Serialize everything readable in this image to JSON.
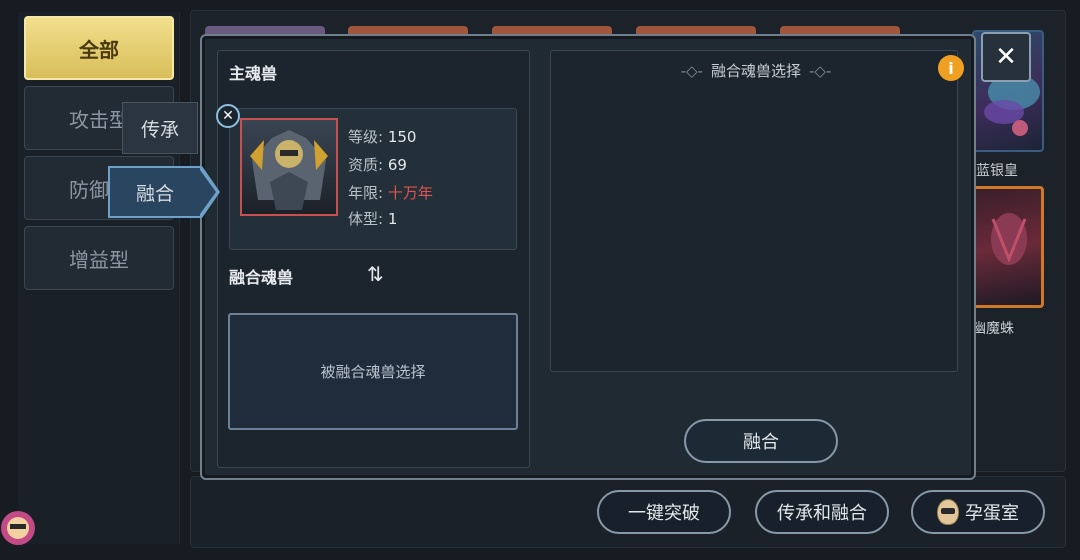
{
  "sidebar": {
    "categories": [
      "全部",
      "攻击型",
      "防御型",
      "增益型"
    ]
  },
  "side_cards": [
    "蓝银皇",
    "幽魔蛛"
  ],
  "side_tabs": {
    "inherit": "传承",
    "fuse": "融合"
  },
  "main_beast": {
    "title": "主魂兽",
    "level_label": "等级:",
    "level": "150",
    "quality_label": "资质:",
    "quality": "69",
    "age_label": "年限:",
    "age": "十万年",
    "size_label": "体型:",
    "size": "1"
  },
  "fusion": {
    "section_title": "融合魂兽",
    "swap_icon": "⇅",
    "select_placeholder": "被融合魂兽选择",
    "right_title": "融合魂兽选择",
    "fuse_button": "融合"
  },
  "bottom_bar": {
    "breakthrough": "一键突破",
    "inherit_fuse": "传承和融合",
    "hatchery": "孕蛋室"
  },
  "icons": {
    "close": "✕",
    "info": "i"
  },
  "colors": {
    "accent_gold": "#e6cf6e",
    "age_red": "#e0544f",
    "info_orange": "#f0a020"
  }
}
